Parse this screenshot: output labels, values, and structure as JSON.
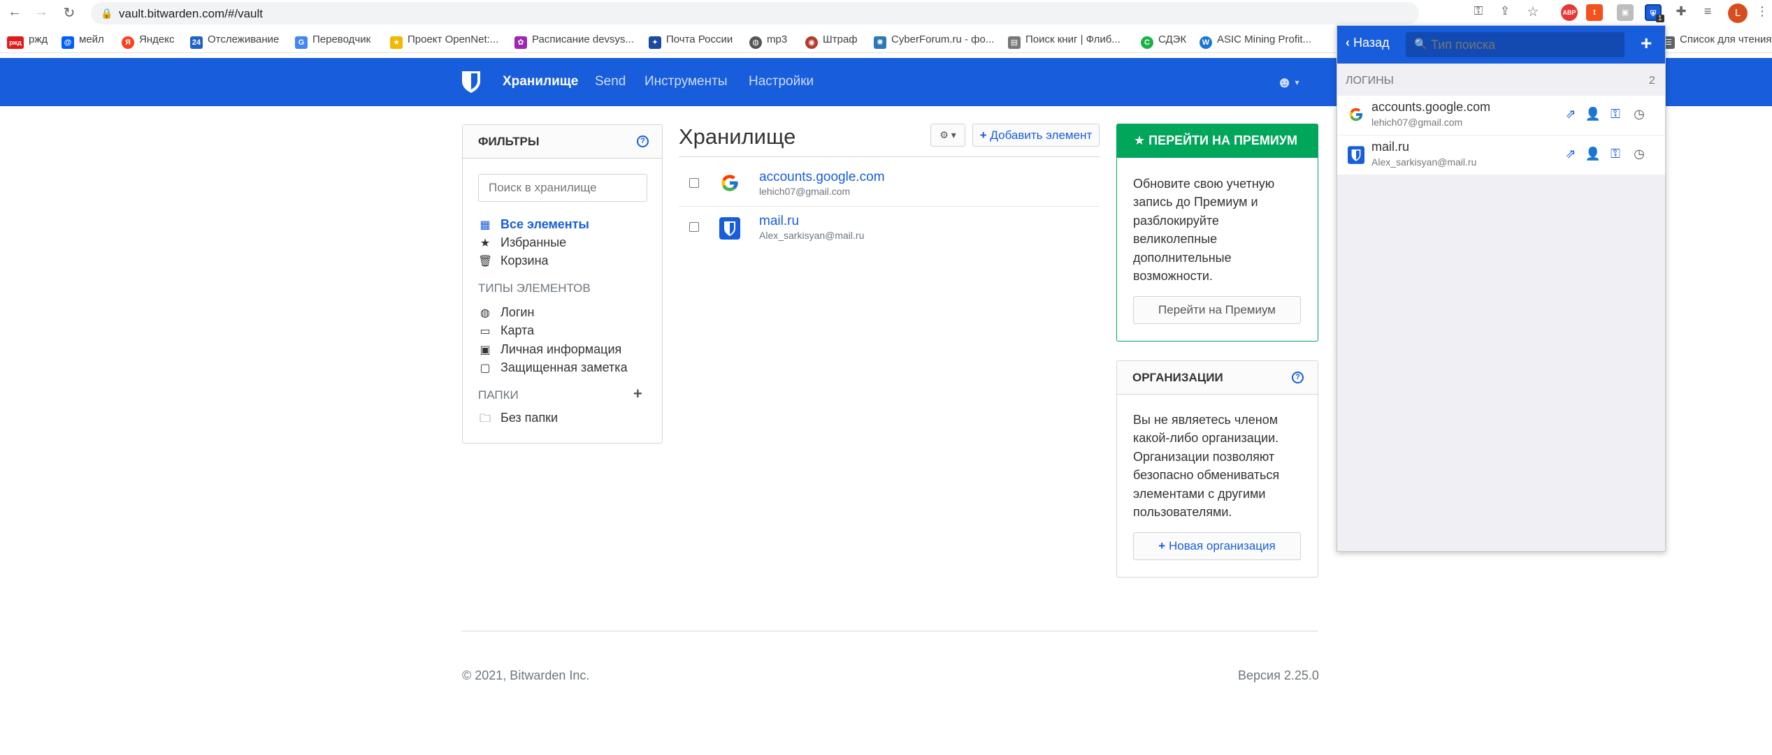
{
  "browser": {
    "url": "vault.bitwarden.com/#/vault",
    "avatar_letter": "L",
    "ext_badge": "1",
    "ext_abp": "ABP",
    "bookmarks": [
      {
        "label": "ржд",
        "color": "#e21a1a",
        "glyph": "ржд"
      },
      {
        "label": "мейл",
        "color": "#005ff9",
        "glyph": "@"
      },
      {
        "label": "Яндекс",
        "color": "#fc3f1d",
        "glyph": "Я"
      },
      {
        "label": "Отслеживание",
        "color": "#1e63c9",
        "glyph": "24"
      },
      {
        "label": "Переводчик",
        "color": "#4285f4",
        "glyph": "G"
      },
      {
        "label": "Проект OpenNet:...",
        "color": "#f2b800",
        "glyph": "★"
      },
      {
        "label": "Расписание devsys...",
        "color": "#9c27b0",
        "glyph": "✿"
      },
      {
        "label": "Почта России",
        "color": "#1a4ba0",
        "glyph": "✦"
      },
      {
        "label": "mp3",
        "color": "#555555",
        "glyph": "◍"
      },
      {
        "label": "Штраф",
        "color": "#b33a2a",
        "glyph": "◉"
      },
      {
        "label": "CyberForum.ru - фо...",
        "color": "#2a7ab8",
        "glyph": "✺"
      },
      {
        "label": "Поиск книг | Флиб...",
        "color": "#777777",
        "glyph": "▤"
      },
      {
        "label": "СДЭК",
        "color": "#1ab248",
        "glyph": "C"
      },
      {
        "label": "ASIC Mining Profit...",
        "color": "#1976d2",
        "glyph": "W"
      },
      {
        "label": "Список для чтения",
        "color": "#5f6368",
        "glyph": "☰"
      }
    ]
  },
  "navbar": {
    "items": [
      "Хранилище",
      "Send",
      "Инструменты",
      "Настройки"
    ]
  },
  "filters": {
    "title": "ФИЛЬТРЫ",
    "search_placeholder": "Поиск в хранилище",
    "all_items": "Все элементы",
    "favorites": "Избранные",
    "trash": "Корзина",
    "types_title": "ТИПЫ ЭЛЕМЕНТОВ",
    "types": [
      "Логин",
      "Карта",
      "Личная информация",
      "Защищенная заметка"
    ],
    "folders_title": "ПАПКИ",
    "no_folder": "Без папки"
  },
  "vault": {
    "title": "Хранилище",
    "add_button": "Добавить элемент",
    "items": [
      {
        "name": "accounts.google.com",
        "user": "lehich07@gmail.com"
      },
      {
        "name": "mail.ru",
        "user": "Alex_sarkisyan@mail.ru"
      }
    ]
  },
  "premium": {
    "header": "ПЕРЕЙТИ НА ПРЕМИУМ",
    "text": [
      "Обновите свою учетную",
      "запись до Премиум и",
      "разблокируйте",
      "великолепные",
      "дополнительные",
      "возможности."
    ],
    "button": "Перейти на Премиум"
  },
  "orgs": {
    "title": "ОРГАНИЗАЦИИ",
    "text": [
      "Вы не являетесь членом",
      "какой-либо организации.",
      "Организации позволяют",
      "безопасно обмениваться",
      "элементами с другими",
      "пользователями."
    ],
    "button": "Новая организация"
  },
  "footer": {
    "copyright": "© 2021, Bitwarden Inc.",
    "version": "Версия 2.25.0"
  },
  "popup": {
    "back": "Назад",
    "search_placeholder": "Тип поиска",
    "section": "ЛОГИНЫ",
    "count": "2",
    "items": [
      {
        "name": "accounts.google.com",
        "user": "lehich07@gmail.com"
      },
      {
        "name": "mail.ru",
        "user": "Alex_sarkisyan@mail.ru"
      }
    ]
  }
}
